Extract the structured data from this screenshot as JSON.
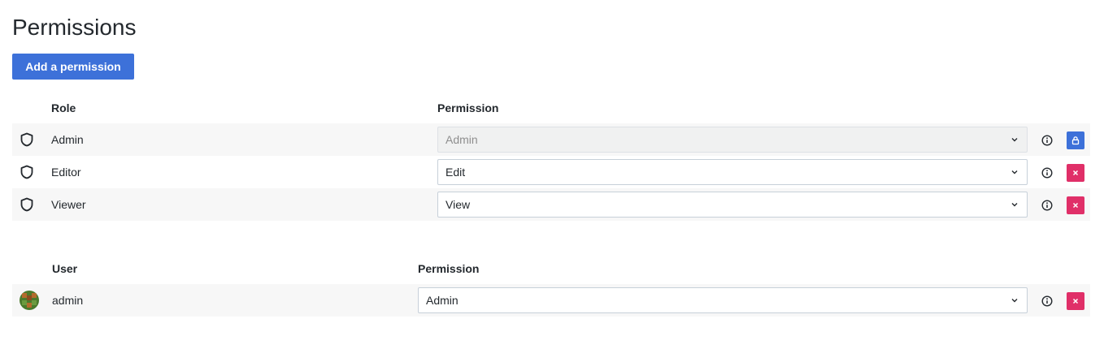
{
  "page": {
    "title": "Permissions",
    "add_button": "Add a permission"
  },
  "roles": {
    "header_role": "Role",
    "header_permission": "Permission",
    "rows": [
      {
        "name": "Admin",
        "permission": "Admin",
        "disabled": true,
        "action": "lock"
      },
      {
        "name": "Editor",
        "permission": "Edit",
        "disabled": false,
        "action": "remove"
      },
      {
        "name": "Viewer",
        "permission": "View",
        "disabled": false,
        "action": "remove"
      }
    ]
  },
  "users": {
    "header_user": "User",
    "header_permission": "Permission",
    "rows": [
      {
        "name": "admin",
        "permission": "Admin",
        "action": "remove"
      }
    ]
  },
  "colors": {
    "primary": "#3d71d9",
    "danger": "#e02f68",
    "row_shade": "#f7f7f7"
  },
  "icons": {
    "role": "shield-icon",
    "info": "info-circle-icon",
    "lock": "lock-icon",
    "remove": "close-icon",
    "chevron": "chevron-down-icon",
    "user": "avatar"
  }
}
